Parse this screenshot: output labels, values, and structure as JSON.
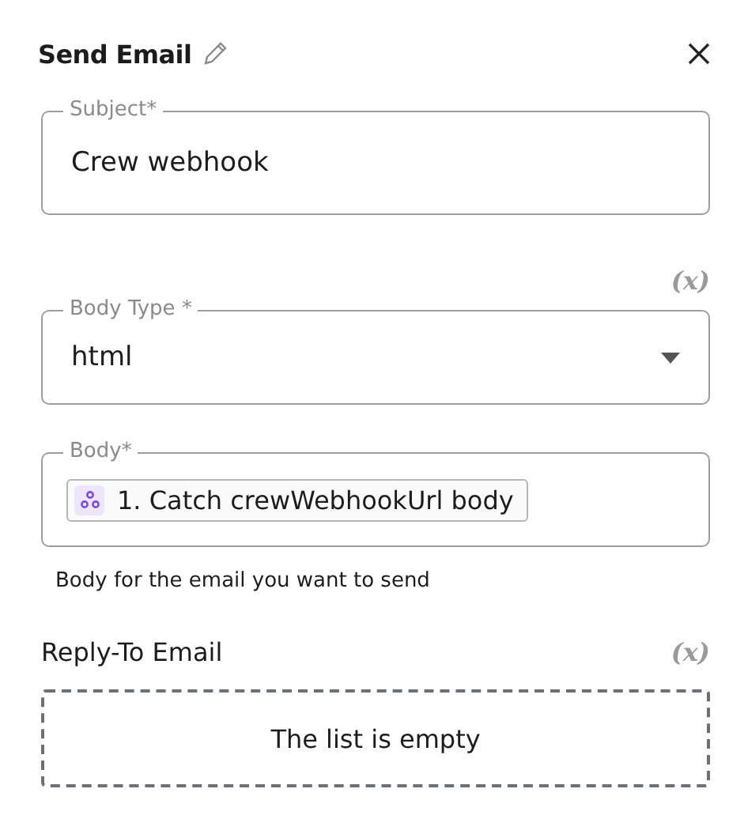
{
  "header": {
    "title": "Send Email"
  },
  "subject": {
    "label": "Subject*",
    "value": "Crew webhook"
  },
  "body_type": {
    "toggle": "(x)",
    "label": "Body Type *",
    "value": "html"
  },
  "body": {
    "label": "Body*",
    "chip": "1. Catch crewWebhookUrl body",
    "hint": "Body for the email you want to send"
  },
  "reply_to": {
    "label": "Reply-To Email",
    "toggle": "(x)",
    "empty_text": "The list is empty"
  }
}
